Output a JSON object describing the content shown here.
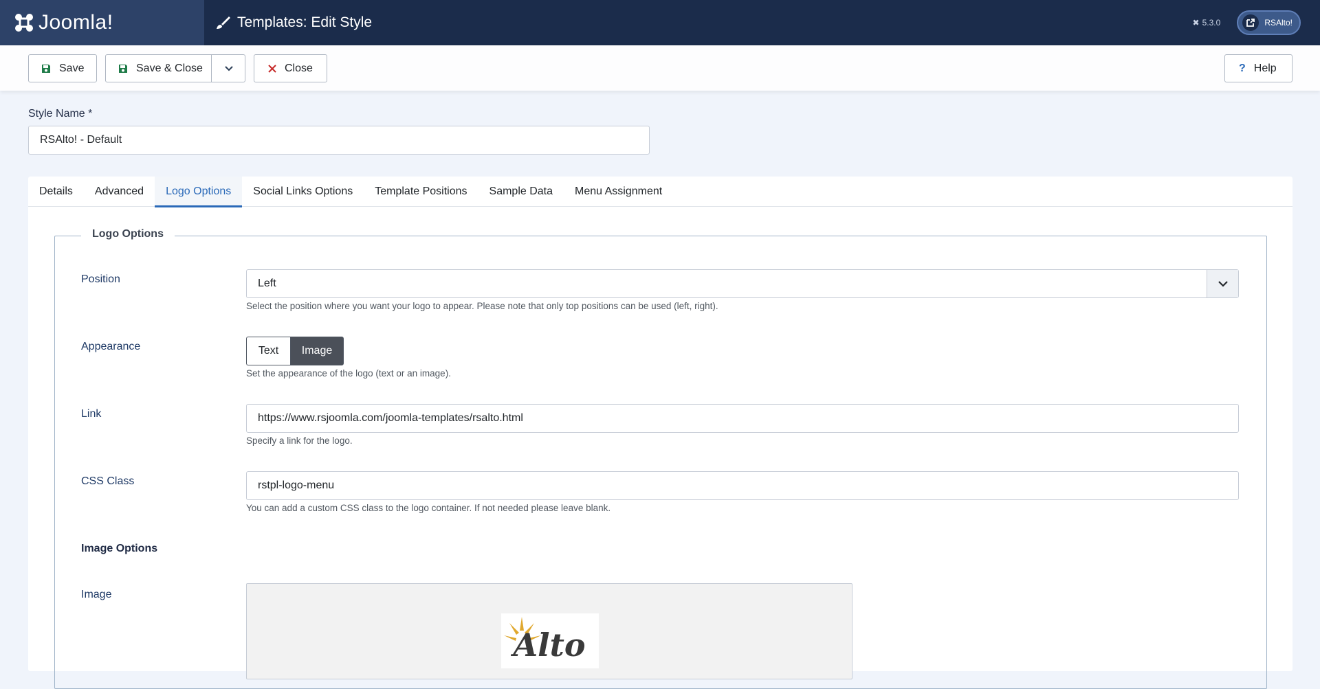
{
  "header": {
    "brand": "Joomla!",
    "title": "Templates: Edit Style",
    "version": "5.3.0",
    "site_button": "RSAlto!"
  },
  "toolbar": {
    "save": "Save",
    "save_close": "Save & Close",
    "close": "Close",
    "help": "Help"
  },
  "style_name": {
    "label": "Style Name *",
    "value": "RSAlto! - Default"
  },
  "tabs": [
    {
      "label": "Details",
      "active": false
    },
    {
      "label": "Advanced",
      "active": false
    },
    {
      "label": "Logo Options",
      "active": true
    },
    {
      "label": "Social Links Options",
      "active": false
    },
    {
      "label": "Template Positions",
      "active": false
    },
    {
      "label": "Sample Data",
      "active": false
    },
    {
      "label": "Menu Assignment",
      "active": false
    }
  ],
  "logo_options": {
    "legend": "Logo Options",
    "position": {
      "label": "Position",
      "value": "Left",
      "description": "Select the position where you want your logo to appear. Please note that only top positions can be used (left, right)."
    },
    "appearance": {
      "label": "Appearance",
      "options": [
        "Text",
        "Image"
      ],
      "selected": "Image",
      "description": "Set the appearance of the logo (text or an image)."
    },
    "link": {
      "label": "Link",
      "value": "https://www.rsjoomla.com/joomla-templates/rsalto.html",
      "description": "Specify a link for the logo."
    },
    "css_class": {
      "label": "CSS Class",
      "value": "rstpl-logo-menu",
      "description": "You can add a custom CSS class to the logo container. If not needed please leave blank."
    },
    "image_options_heading": "Image Options",
    "image": {
      "label": "Image",
      "preview_text": "Alto"
    }
  }
}
